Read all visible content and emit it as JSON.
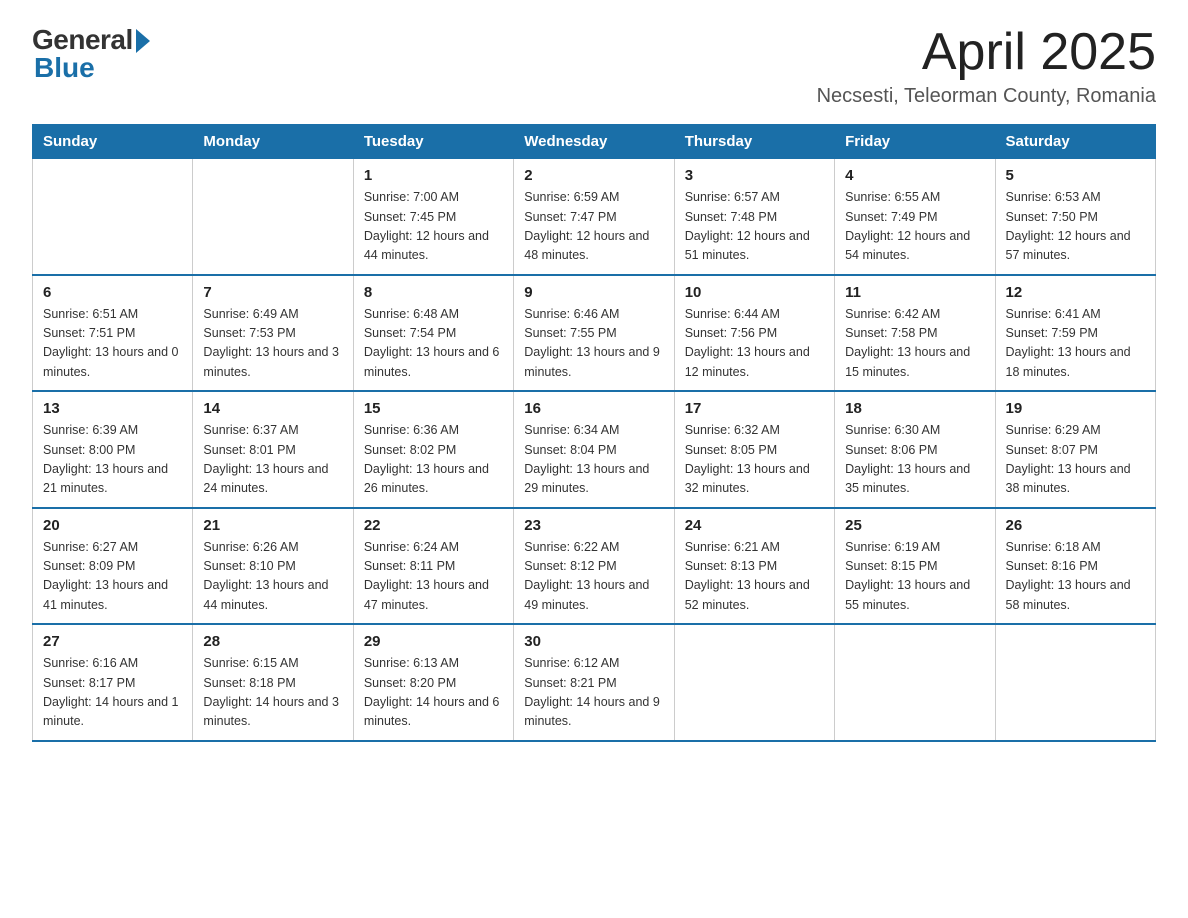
{
  "logo": {
    "general": "General",
    "blue": "Blue"
  },
  "header": {
    "month": "April 2025",
    "location": "Necsesti, Teleorman County, Romania"
  },
  "days_of_week": [
    "Sunday",
    "Monday",
    "Tuesday",
    "Wednesday",
    "Thursday",
    "Friday",
    "Saturday"
  ],
  "weeks": [
    [
      {
        "day": "",
        "detail": ""
      },
      {
        "day": "",
        "detail": ""
      },
      {
        "day": "1",
        "detail": "Sunrise: 7:00 AM\nSunset: 7:45 PM\nDaylight: 12 hours\nand 44 minutes."
      },
      {
        "day": "2",
        "detail": "Sunrise: 6:59 AM\nSunset: 7:47 PM\nDaylight: 12 hours\nand 48 minutes."
      },
      {
        "day": "3",
        "detail": "Sunrise: 6:57 AM\nSunset: 7:48 PM\nDaylight: 12 hours\nand 51 minutes."
      },
      {
        "day": "4",
        "detail": "Sunrise: 6:55 AM\nSunset: 7:49 PM\nDaylight: 12 hours\nand 54 minutes."
      },
      {
        "day": "5",
        "detail": "Sunrise: 6:53 AM\nSunset: 7:50 PM\nDaylight: 12 hours\nand 57 minutes."
      }
    ],
    [
      {
        "day": "6",
        "detail": "Sunrise: 6:51 AM\nSunset: 7:51 PM\nDaylight: 13 hours\nand 0 minutes."
      },
      {
        "day": "7",
        "detail": "Sunrise: 6:49 AM\nSunset: 7:53 PM\nDaylight: 13 hours\nand 3 minutes."
      },
      {
        "day": "8",
        "detail": "Sunrise: 6:48 AM\nSunset: 7:54 PM\nDaylight: 13 hours\nand 6 minutes."
      },
      {
        "day": "9",
        "detail": "Sunrise: 6:46 AM\nSunset: 7:55 PM\nDaylight: 13 hours\nand 9 minutes."
      },
      {
        "day": "10",
        "detail": "Sunrise: 6:44 AM\nSunset: 7:56 PM\nDaylight: 13 hours\nand 12 minutes."
      },
      {
        "day": "11",
        "detail": "Sunrise: 6:42 AM\nSunset: 7:58 PM\nDaylight: 13 hours\nand 15 minutes."
      },
      {
        "day": "12",
        "detail": "Sunrise: 6:41 AM\nSunset: 7:59 PM\nDaylight: 13 hours\nand 18 minutes."
      }
    ],
    [
      {
        "day": "13",
        "detail": "Sunrise: 6:39 AM\nSunset: 8:00 PM\nDaylight: 13 hours\nand 21 minutes."
      },
      {
        "day": "14",
        "detail": "Sunrise: 6:37 AM\nSunset: 8:01 PM\nDaylight: 13 hours\nand 24 minutes."
      },
      {
        "day": "15",
        "detail": "Sunrise: 6:36 AM\nSunset: 8:02 PM\nDaylight: 13 hours\nand 26 minutes."
      },
      {
        "day": "16",
        "detail": "Sunrise: 6:34 AM\nSunset: 8:04 PM\nDaylight: 13 hours\nand 29 minutes."
      },
      {
        "day": "17",
        "detail": "Sunrise: 6:32 AM\nSunset: 8:05 PM\nDaylight: 13 hours\nand 32 minutes."
      },
      {
        "day": "18",
        "detail": "Sunrise: 6:30 AM\nSunset: 8:06 PM\nDaylight: 13 hours\nand 35 minutes."
      },
      {
        "day": "19",
        "detail": "Sunrise: 6:29 AM\nSunset: 8:07 PM\nDaylight: 13 hours\nand 38 minutes."
      }
    ],
    [
      {
        "day": "20",
        "detail": "Sunrise: 6:27 AM\nSunset: 8:09 PM\nDaylight: 13 hours\nand 41 minutes."
      },
      {
        "day": "21",
        "detail": "Sunrise: 6:26 AM\nSunset: 8:10 PM\nDaylight: 13 hours\nand 44 minutes."
      },
      {
        "day": "22",
        "detail": "Sunrise: 6:24 AM\nSunset: 8:11 PM\nDaylight: 13 hours\nand 47 minutes."
      },
      {
        "day": "23",
        "detail": "Sunrise: 6:22 AM\nSunset: 8:12 PM\nDaylight: 13 hours\nand 49 minutes."
      },
      {
        "day": "24",
        "detail": "Sunrise: 6:21 AM\nSunset: 8:13 PM\nDaylight: 13 hours\nand 52 minutes."
      },
      {
        "day": "25",
        "detail": "Sunrise: 6:19 AM\nSunset: 8:15 PM\nDaylight: 13 hours\nand 55 minutes."
      },
      {
        "day": "26",
        "detail": "Sunrise: 6:18 AM\nSunset: 8:16 PM\nDaylight: 13 hours\nand 58 minutes."
      }
    ],
    [
      {
        "day": "27",
        "detail": "Sunrise: 6:16 AM\nSunset: 8:17 PM\nDaylight: 14 hours\nand 1 minute."
      },
      {
        "day": "28",
        "detail": "Sunrise: 6:15 AM\nSunset: 8:18 PM\nDaylight: 14 hours\nand 3 minutes."
      },
      {
        "day": "29",
        "detail": "Sunrise: 6:13 AM\nSunset: 8:20 PM\nDaylight: 14 hours\nand 6 minutes."
      },
      {
        "day": "30",
        "detail": "Sunrise: 6:12 AM\nSunset: 8:21 PM\nDaylight: 14 hours\nand 9 minutes."
      },
      {
        "day": "",
        "detail": ""
      },
      {
        "day": "",
        "detail": ""
      },
      {
        "day": "",
        "detail": ""
      }
    ]
  ]
}
